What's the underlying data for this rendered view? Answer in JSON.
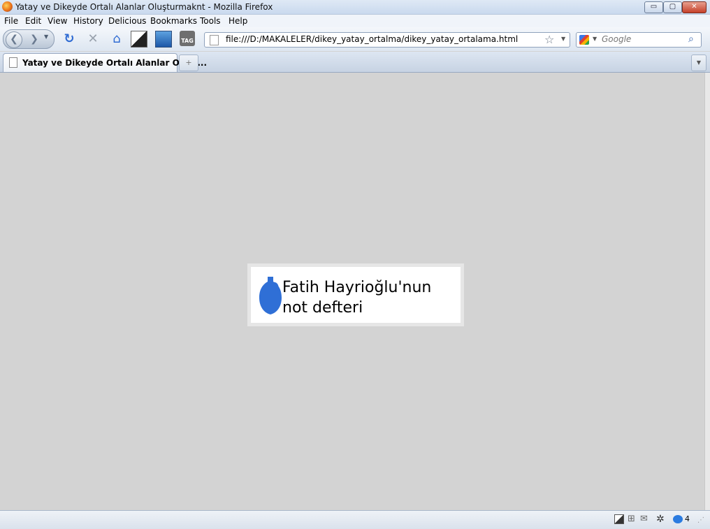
{
  "window": {
    "title": "Yatay ve Dikeyde Ortalı Alanlar Oluşturmaknt - Mozilla Firefox",
    "minimize": "▭",
    "maximize": "▢",
    "close": "✕"
  },
  "menu": {
    "items": [
      "File",
      "Edit",
      "View",
      "History",
      "Delicious",
      "Bookmarks",
      "Tools",
      "Help"
    ]
  },
  "toolbar": {
    "back_icon": "❮",
    "forward_icon": "❯",
    "reload_icon": "↻",
    "stop_icon": "✕",
    "home_icon": "⌂",
    "tag_label": "TAG"
  },
  "urlbar": {
    "value": "file:///D:/MAKALELER/dikey_yatay_ortalma/dikey_yatay_ortalama.html"
  },
  "search": {
    "placeholder": "Google"
  },
  "tabs": [
    {
      "label": "Yatay ve Dikeyde Ortalı Alanlar Oluşt..."
    }
  ],
  "tabstrip": {
    "new_tab_icon": "+"
  },
  "content": {
    "logo_line1": "Fatih Hayrioğlu'nun",
    "logo_line2": "not defteri",
    "logo_color": "#2f6fd6"
  },
  "status": {
    "badge_count": "4"
  }
}
